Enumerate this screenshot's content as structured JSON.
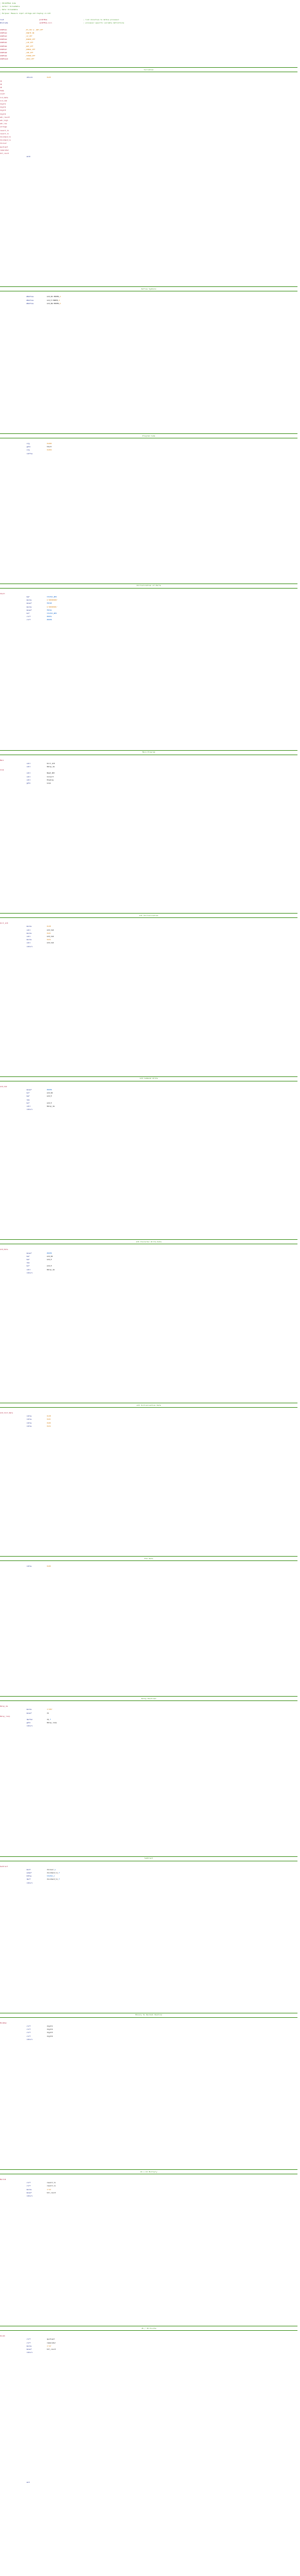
{
  "editor": {
    "language": "PIC assembly",
    "colors": {
      "comment": "#4d9a2e",
      "label": "#b5304a",
      "instruction": "#1b2a8a",
      "number": "#d8861a",
      "register": "#1f6fd1",
      "text": "#222222"
    }
  },
  "header": [
    "; PIC16F84A Code",
    "; Author: Unreadable",
    "; Date: Unreadable",
    "; Purpose: Measure input voltage and display on LCD"
  ],
  "config": [
    {
      "c1": "list",
      "c2": "p=16f84a",
      "c3": "; list directive to define processor"
    },
    {
      "c1": "#include",
      "c2": "<p16F84a.inc>",
      "c3": "; processor specific variable definitions"
    }
  ],
  "equates": [
    "CONFIG1  _HS_OSC & _WDT_OFF",
    "CONFIG2  _PWRTE_ON",
    "CONFIG3  _CP_OFF",
    "CONFIG4  _BOREN_OFF",
    "CONFIG5  _LVP_OFF",
    "CONFIG6  _WRT_OFF",
    "CONFIG7  _DEBUG_OFF",
    "CONFIG8  _CPD_OFF",
    "CONFIG9  _FCMEN_OFF",
    "CONFIG10 _IESO_OFF"
  ],
  "sections": [
    {
      "title": "Variables",
      "lines": [
        "cblock 0x20",
        "d1",
        "d2",
        "d3",
        "temp",
        "count",
        "lcd_data",
        "lcd_cmd",
        "digit1",
        "digit2",
        "digit3",
        "digit4",
        "adc_result",
        "adc_high",
        "adc_low",
        "voltage",
        "result_hi",
        "result_lo",
        "dividend_hi",
        "dividend_lo",
        "divisor",
        "quotient",
        "remainder",
        "bit_count",
        "endc"
      ]
    },
    {
      "title": "Define Symbols",
      "lines": [
        "#define LCD_RS PORTB,4",
        "#define LCD_E PORTB,5",
        "#define LCD_RW PORTB,6"
      ]
    },
    {
      "title": "Program Code",
      "lines": [
        "org 0x000",
        "goto Start",
        "org 0x004",
        "retfie"
      ]
    },
    {
      "title": "Initialization of Ports",
      "lines": [
        "Start",
        "bsf STATUS,RP0",
        "movlw b'00000000'",
        "movwf TRISB",
        "movlw b'00000001'",
        "movwf TRISA",
        "bcf STATUS,RP0",
        "clrf PORTA",
        "clrf PORTB"
      ]
    },
    {
      "title": "Main Program",
      "lines": [
        "Main",
        "call Init_LCD",
        "call Delay_ms",
        "Loop",
        "call Read_ADC",
        "call Convert",
        "call Display",
        "goto Loop"
      ]
    },
    {
      "title": "LCD Initialization",
      "lines": [
        "Init_LCD",
        "movlw 0x38",
        "call LCD_Cmd",
        "movlw 0x0C",
        "call LCD_Cmd",
        "movlw 0x01",
        "call LCD_Cmd",
        "return"
      ]
    },
    {
      "title": "LCD Command Write",
      "lines": [
        "LCD_Cmd",
        "movwf PORTB",
        "bcf LCD_RS",
        "bsf LCD_E",
        "nop",
        "bcf LCD_E",
        "call Delay_ms",
        "return"
      ]
    },
    {
      "title": "LCD Character Write Data",
      "lines": [
        "LCD_Data",
        "movwf PORTB",
        "bsf LCD_RS",
        "bsf LCD_E",
        "nop",
        "bcf LCD_E",
        "call Delay_ms",
        "return"
      ]
    },
    {
      "title": "LCD Initialization Data",
      "lines": [
        "LCD_Init_Data",
        "retlw 0x38",
        "retlw 0x0C",
        "retlw 0x06",
        "retlw 0x01"
      ]
    },
    {
      "title": "End Data",
      "lines": [
        "retlw 0x00"
      ]
    },
    {
      "title": "Delay Routines",
      "lines": [
        "Delay_ms",
        "movlw d'250'",
        "movwf d1",
        "Delay_loop",
        "decfsz d1,f",
        "goto Delay_loop",
        "return"
      ]
    },
    {
      "title": "Subtract",
      "lines": [
        "Subtract",
        "movf divisor,w",
        "subwf dividend_lo,f",
        "btfss STATUS,C",
        "decf dividend_hi,f",
        "return"
      ]
    },
    {
      "title": "Binary to Decimal Routine",
      "lines": [
        "Bin2Dec",
        "clrf digit1",
        "clrf digit2",
        "clrf digit3",
        "clrf digit4",
        "return"
      ]
    },
    {
      "title": "16 x 16 Multiply",
      "lines": [
        "Mult16",
        "clrf result_hi",
        "clrf result_lo",
        "movlw d'16'",
        "movwf bit_count",
        "return"
      ]
    },
    {
      "title": "16 / 16 Divide",
      "lines": [
        "Div16",
        "clrf quotient",
        "clrf remainder",
        "movlw d'16'",
        "movwf bit_count",
        "return"
      ]
    }
  ],
  "footer": [
    "end"
  ]
}
